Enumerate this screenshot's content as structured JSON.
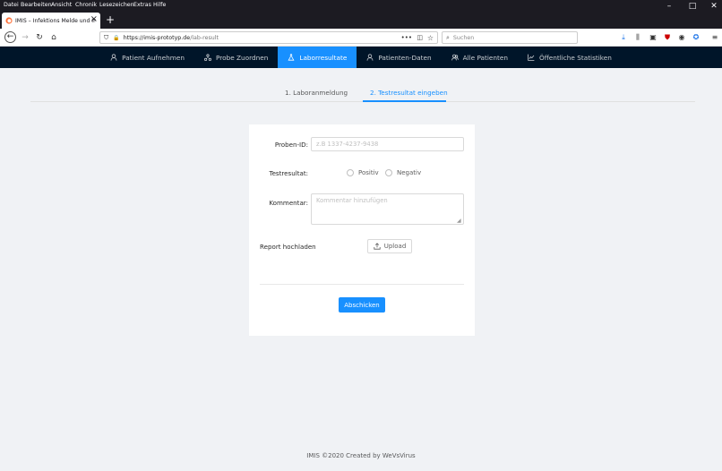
{
  "browser": {
    "menu": [
      "Datei",
      "Bearbeiten",
      "Ansicht",
      "Chronik",
      "Lesezeichen",
      "Extras",
      "Hilfe"
    ],
    "tab_title": "IMIS – Infektions Melde und In",
    "url_domain": "https://imis-prototyp.de",
    "url_path": "/lab-result",
    "search_placeholder": "Suchen"
  },
  "nav": {
    "items": [
      "Patient Aufnehmen",
      "Probe Zuordnen",
      "Laborresultate",
      "Patienten-Daten",
      "Alle Patienten",
      "Öffentliche Statistiken"
    ],
    "active_index": 2,
    "active_color": "#1890ff",
    "bg_color": "#001529"
  },
  "steps": {
    "step1": "1. Laboranmeldung",
    "step2": "2. Testresultat eingeben"
  },
  "form": {
    "proben_label": "Proben-ID",
    "proben_placeholder": "z.B 1337-4237-9438",
    "test_label": "Testresultat",
    "positiv": "Positiv",
    "negativ": "Negativ",
    "kommentar_label": "Kommentar",
    "kommentar_placeholder": "Kommentar hinzufügen",
    "report_label": "Report hochladen",
    "upload_label": "Upload",
    "submit_label": "Abschicken"
  },
  "footer": "IMIS ©2020 Created by WeVsVirus"
}
